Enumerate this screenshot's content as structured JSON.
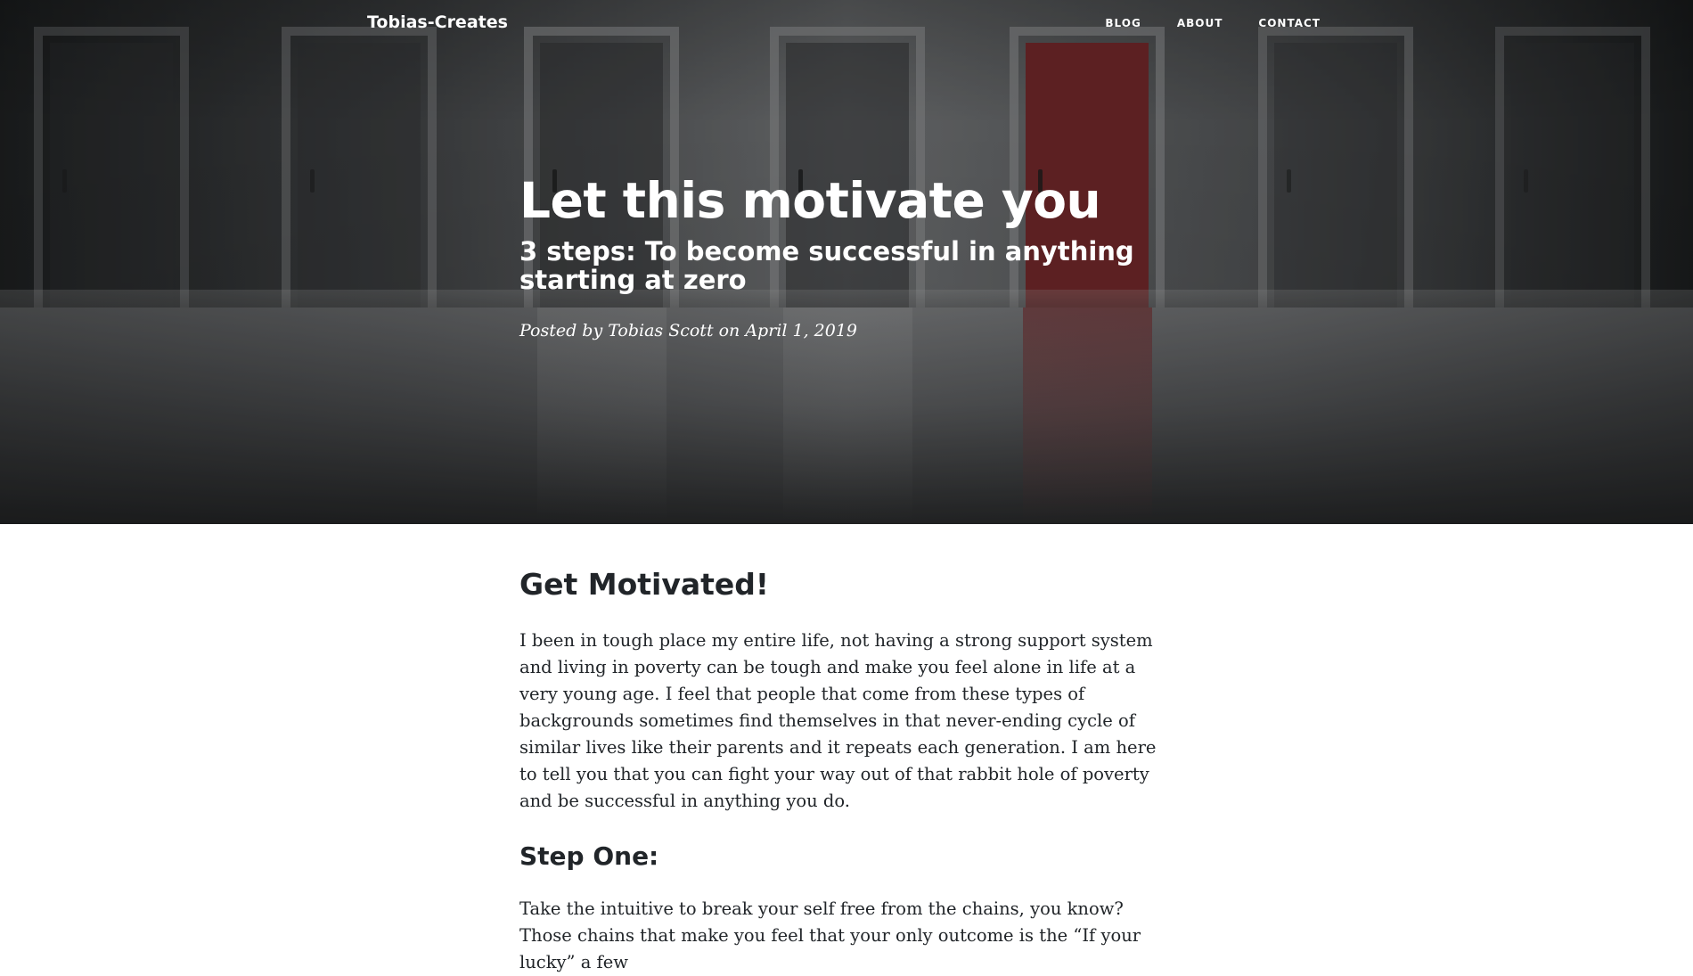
{
  "nav": {
    "brand": "Tobias-Creates",
    "links": [
      {
        "label": "Blog"
      },
      {
        "label": "About"
      },
      {
        "label": "Contact"
      }
    ]
  },
  "header": {
    "title": "Let this motivate you",
    "subtitle": "3 steps: To become successful in anything starting at zero",
    "meta": "Posted by Tobias Scott on April 1, 2019"
  },
  "article": {
    "heading": "Get Motivated!",
    "intro": "I been in tough place my entire life, not having a strong support system and living in poverty can be tough and make you feel alone in life at a very young age. I feel that people that come from these types of backgrounds sometimes find themselves in that never-ending cycle of similar lives like their parents and it repeats each generation. I am here to tell you that you can fight your way out of that rabbit hole of poverty and be successful in anything you do.",
    "step_one_heading": "Step One:",
    "step_one_text": "Take the intuitive to break your self free from the chains, you know? Those chains that make you feel that your only outcome is the “If your lucky” a few"
  },
  "colors": {
    "accent_door": "#6a1f21",
    "text": "#212529"
  }
}
